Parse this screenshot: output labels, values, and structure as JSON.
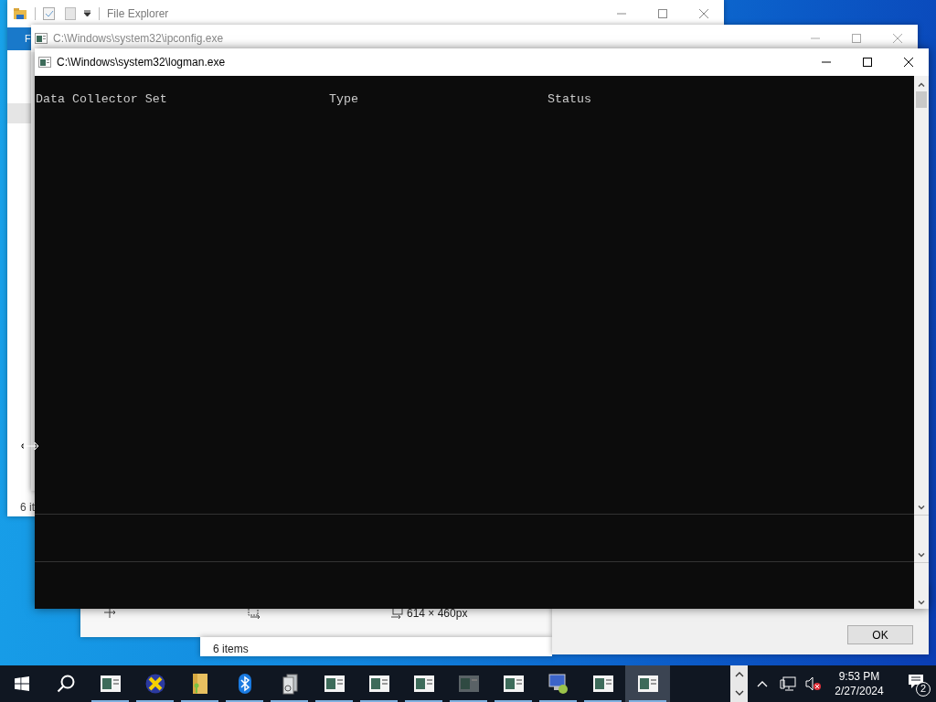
{
  "file_explorer": {
    "title": "File Explorer",
    "ribbon_tab": "F",
    "status": "6 it"
  },
  "ipconfig_window": {
    "title": "C:\\Windows\\system32\\ipconfig.exe"
  },
  "logman_window": {
    "title": "C:\\Windows\\system32\\logman.exe",
    "columns": [
      "Data Collector Set",
      "Type",
      "Status"
    ]
  },
  "image_viewer": {
    "dimensions": "614 × 460px"
  },
  "explorer_window": {
    "status": "6 items"
  },
  "dialog": {
    "button": "OK"
  },
  "taskbar": {
    "apps": [
      {
        "kind": "console",
        "selected": false
      },
      {
        "kind": "x_badge",
        "selected": false
      },
      {
        "kind": "folder_key",
        "selected": false
      },
      {
        "kind": "bluetooth",
        "selected": false
      },
      {
        "kind": "documents",
        "selected": false
      },
      {
        "kind": "console",
        "selected": false
      },
      {
        "kind": "console",
        "selected": false
      },
      {
        "kind": "console",
        "selected": false
      },
      {
        "kind": "console_dim",
        "selected": false
      },
      {
        "kind": "console",
        "selected": false
      },
      {
        "kind": "monitor",
        "selected": false
      },
      {
        "kind": "console",
        "selected": false
      },
      {
        "kind": "console",
        "selected": true
      }
    ],
    "time": "9:53 PM",
    "date": "2/27/2024",
    "notification_count": "2"
  }
}
